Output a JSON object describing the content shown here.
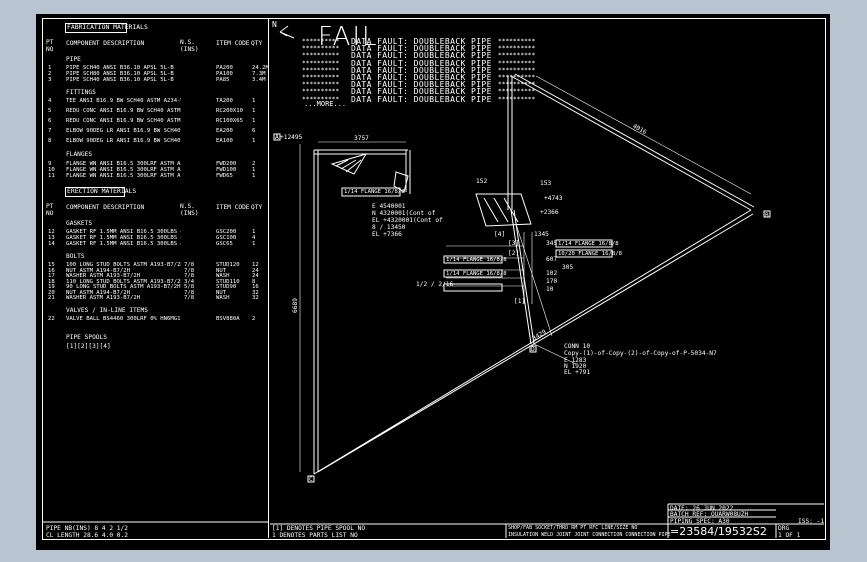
{
  "material_list": {
    "fabrication_title": "FABRICATION MATERIALS",
    "col_pt": "PT NO",
    "col_desc": "COMPONENT DESCRIPTION",
    "col_ns": "N.S. (INS)",
    "col_item": "ITEM CODE",
    "col_qty": "QTY",
    "section_pipe": "PIPE",
    "pipe_rows": [
      {
        "pt": "1",
        "desc": "PIPE SCH40 ANSI B36.10 APSL 5L-B",
        "item": "PA200",
        "qty": "24.2M"
      },
      {
        "pt": "2",
        "desc": "PIPE SCH80 ANSI B36.10 APSL 5L-B",
        "item": "PA100",
        "qty": "7.3M"
      },
      {
        "pt": "3",
        "desc": "PIPE SCH40 ANSI B36.10 APSL 5L-B",
        "item": "PA85",
        "qty": "3.4M"
      }
    ],
    "section_fittings": "FITTINGS",
    "fitting_rows": [
      {
        "pt": "4",
        "desc": "TEE ANSI B16.9 BW SCH40 ASTM A234-WPB",
        "item": "TA200",
        "qty": "1"
      },
      {
        "pt": "5",
        "desc": "REDU CONC ANSI B16.9 BW SCH40 ASTM A234-WPB",
        "item": "RC200X10",
        "qty": "1"
      },
      {
        "pt": "6",
        "desc": "REDU CONC ANSI B16.9 BW SCH40 ASTM 1/2 A234-WPB",
        "item": "RC100X65",
        "qty": "1"
      },
      {
        "pt": "7",
        "desc": "ELBOW 90DEG LR ANSI B16.9 BW SCH40 ASTM A234-WPB",
        "item": "EA200",
        "qty": "6"
      },
      {
        "pt": "8",
        "desc": "ELBOW 90DEG LR ANSI B16.9 BW SCH40 ASTM A234-WPB",
        "item": "EA100",
        "qty": "1"
      }
    ],
    "section_flanges": "FLANGES",
    "flange_rows": [
      {
        "pt": "9",
        "desc": "FLANGE WN ANSI B16.5 300LRF ASTM A105",
        "item": "FWD200",
        "qty": "2"
      },
      {
        "pt": "10",
        "desc": "FLANGE WN ANSI B16.5 300LRF ASTM A105",
        "item": "FWD100",
        "qty": "1"
      },
      {
        "pt": "11",
        "desc": "FLANGE WN ANSI B16.5 300LRF ASTM A105",
        "item": "FWD65",
        "qty": "1"
      }
    ],
    "erection_title": "ERECTION MATERIALS",
    "section_gaskets": "GASKETS",
    "gasket_rows": [
      {
        "pt": "12",
        "desc": "GASKET RF 1.5MM ANSI B16.5 300LBS & ASBESTOS",
        "item": "GSC200",
        "qty": "1"
      },
      {
        "pt": "13",
        "desc": "GASKET RF 1.5MM ANSI B16.5 300LBS & ASBESTOS",
        "item": "GSC100",
        "qty": "4"
      },
      {
        "pt": "14",
        "desc": "GASKET RF 1.5MM ANSI B16.5 300LBS & ASBESTOS",
        "item": "GSC65",
        "qty": "1"
      }
    ],
    "section_bolts": "BOLTS",
    "bolt_rows": [
      {
        "pt": "15",
        "desc": "100 LONG STUD BOLTS ASTM A193-B7/2H",
        "item": "STUD120",
        "qty": "12"
      },
      {
        "pt": "16",
        "desc": "NUT ASTM A194-B7/2H",
        "item": "NUT",
        "qty": "24"
      },
      {
        "pt": "17",
        "desc": "WASHER ASTM A193-B7/2H",
        "item": "WASH",
        "qty": "24"
      },
      {
        "pt": "18",
        "desc": "110 LONG STUD BOLTS ASTM A193-B7/2H",
        "item": "STUD110",
        "qty": "8"
      },
      {
        "pt": "19",
        "desc": "90 LONG STUD BOLTS ASTM A193-B7/2H",
        "item": "STUD90",
        "qty": "16"
      },
      {
        "pt": "20",
        "desc": "NUT ASTM A194-B7/2H",
        "item": "NUT",
        "qty": "32"
      },
      {
        "pt": "21",
        "desc": "WASHER ASTM A193-B7/2H",
        "item": "WASH",
        "qty": "32"
      }
    ],
    "bolt_ns": [
      "7/8",
      "7/8",
      "7/8",
      "3/4",
      "5/8",
      "7/8",
      "7/8"
    ],
    "section_valves": "VALVES / IN-LINE ITEMS",
    "valve_rows": [
      {
        "pt": "22",
        "desc": "VALVE BALL BS4460 300LRF 0% HN6MG1 STEEL",
        "item": "BSV880A",
        "qty": "2"
      }
    ],
    "section_spools": "PIPE SPOOLS",
    "spools": "[1][2][3][4]"
  },
  "faults": {
    "title": "FAIL",
    "north": "N",
    "lines": [
      "DATA FAULT: DOUBLEBACK PIPE",
      "DATA FAULT: DOUBLEBACK PIPE",
      "DATA FAULT: DOUBLEBACK PIPE",
      "DATA FAULT: DOUBLEBACK PIPE",
      "DATA FAULT: DOUBLEBACK PIPE",
      "DATA FAULT: DOUBLEBACK PIPE",
      "DATA FAULT: DOUBLEBACK PIPE",
      "DATA FAULT: DOUBLEBACK PIPE",
      "DATA FAULT: DOUBLEBACK PIPE"
    ],
    "more": "...MORE...",
    "stars": "**********"
  },
  "drawing": {
    "dims": {
      "d1": "3757",
      "d2": "4016",
      "d3": "6689",
      "d4": "3429"
    },
    "labels": {
      "elev1": "+12495",
      "elev2": "+2366",
      "elev3": "+4743",
      "elev4": "+3",
      "conn_e": "E 4540001",
      "conn_n": "N 4320001(Cont of",
      "conn_el": "EL +4320001(Cont of",
      "b1": "8 / 13450",
      "b2": "EL +7366",
      "conn10": "CONN 10",
      "conn10_name": "Copy-(1)-of-Copy-(2)-of-Copy-of-P-5034-N7",
      "conn10_e": "E 1283",
      "conn10_n": "N 1920",
      "conn10_el": "EL +791",
      "tag_row1": "1/14 FLANGE 16/8/8",
      "tag_row2": "1/14 FLANGE 16/8/8",
      "tag_row3": "10/20 FLANGE 16/8/8",
      "tag_row4": "1/14 FLANGE 16/8/8",
      "tag_row5": "1/14 FLANGE 16/8/8",
      "dim_345": "345",
      "dim_607": "607",
      "dim_305": "305",
      "dim_102": "102",
      "dim_170": "170",
      "dim_10": "10",
      "dim_152": "152",
      "dim_153": "153",
      "dim_1345": "1345",
      "note_a": "1/2 / 2/16",
      "bracket_a": "[4]",
      "bracket_b": "[3]",
      "bracket_c": "[2]",
      "bracket_d": "[1]",
      "end_a": "A",
      "end_b": "B",
      "end_c": "C",
      "end_d": "D"
    }
  },
  "footer": {
    "pipe_nb": "PIPE NB(INS)   8    4   2 1/2",
    "cl_length": "CL LENGTH   28.6  4.0   0.2",
    "note1": "[1] DENOTES PIPE SPOOL NO",
    "note2": "1  DENOTES PARTS LIST NO",
    "title_date": "DATE: 26 JUN 2022",
    "batch_ref": "BATCH REF: OUARW08UZH",
    "piping_spec": "PIPING SPEC: A30",
    "sheet_row_left": "SHOP/FAB SOCKET/THRD RM  PT  RFC  LINE/SIZE NO",
    "sheet_row_left2": "INSULATION  WELD  JOINT JOINT CONNECTION   CONNECTION  PIPE",
    "pipe_number": "=23584/19532S2",
    "drg": "DRG",
    "drg_of": "1 OF 1",
    "iss": "ISS: -1"
  }
}
